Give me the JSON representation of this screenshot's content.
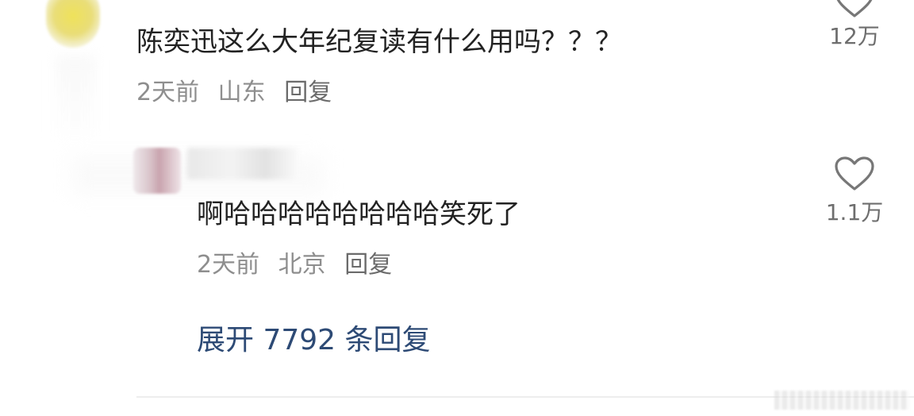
{
  "comment": {
    "text": "陈奕迅这么大年纪复读有什么用吗？？？",
    "time": "2天前",
    "location": "山东",
    "reply_label": "回复",
    "like_count": "12万"
  },
  "reply": {
    "text": "啊哈哈哈哈哈哈哈哈笑死了",
    "time": "2天前",
    "location": "北京",
    "reply_label": "回复",
    "like_count": "1.1万"
  },
  "expand_replies_label": "展开 7792 条回复",
  "icons": {
    "like": "heart-outline-icon"
  },
  "colors": {
    "primary_text": "#222222",
    "meta_text": "#8e8e8e",
    "link": "#2d4a75",
    "heart_stroke": "#777777"
  }
}
